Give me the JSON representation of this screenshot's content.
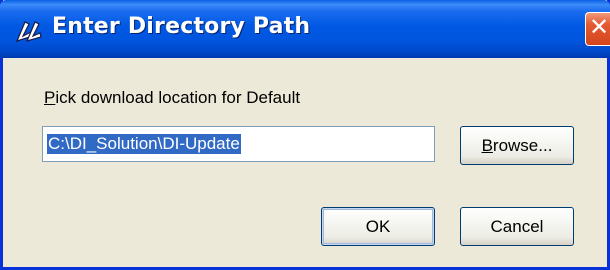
{
  "window": {
    "title": "Enter Directory Path",
    "close_glyph": "✕"
  },
  "prompt": {
    "mnemonic": "P",
    "rest": "ick download location for Default"
  },
  "path_input": {
    "value": "C:\\DI_Solution\\DI-Update",
    "selected": true
  },
  "buttons": {
    "browse": {
      "mnemonic": "B",
      "rest": "rowse..."
    },
    "ok": {
      "label": "OK"
    },
    "cancel": {
      "label": "Cancel"
    }
  },
  "icons": {
    "app": "app-icon",
    "close": "close-icon"
  },
  "colors": {
    "titlebar": "#0058e3",
    "window_bg": "#ece9d8",
    "selection": "#316ac5",
    "close_button": "#d3451d"
  }
}
